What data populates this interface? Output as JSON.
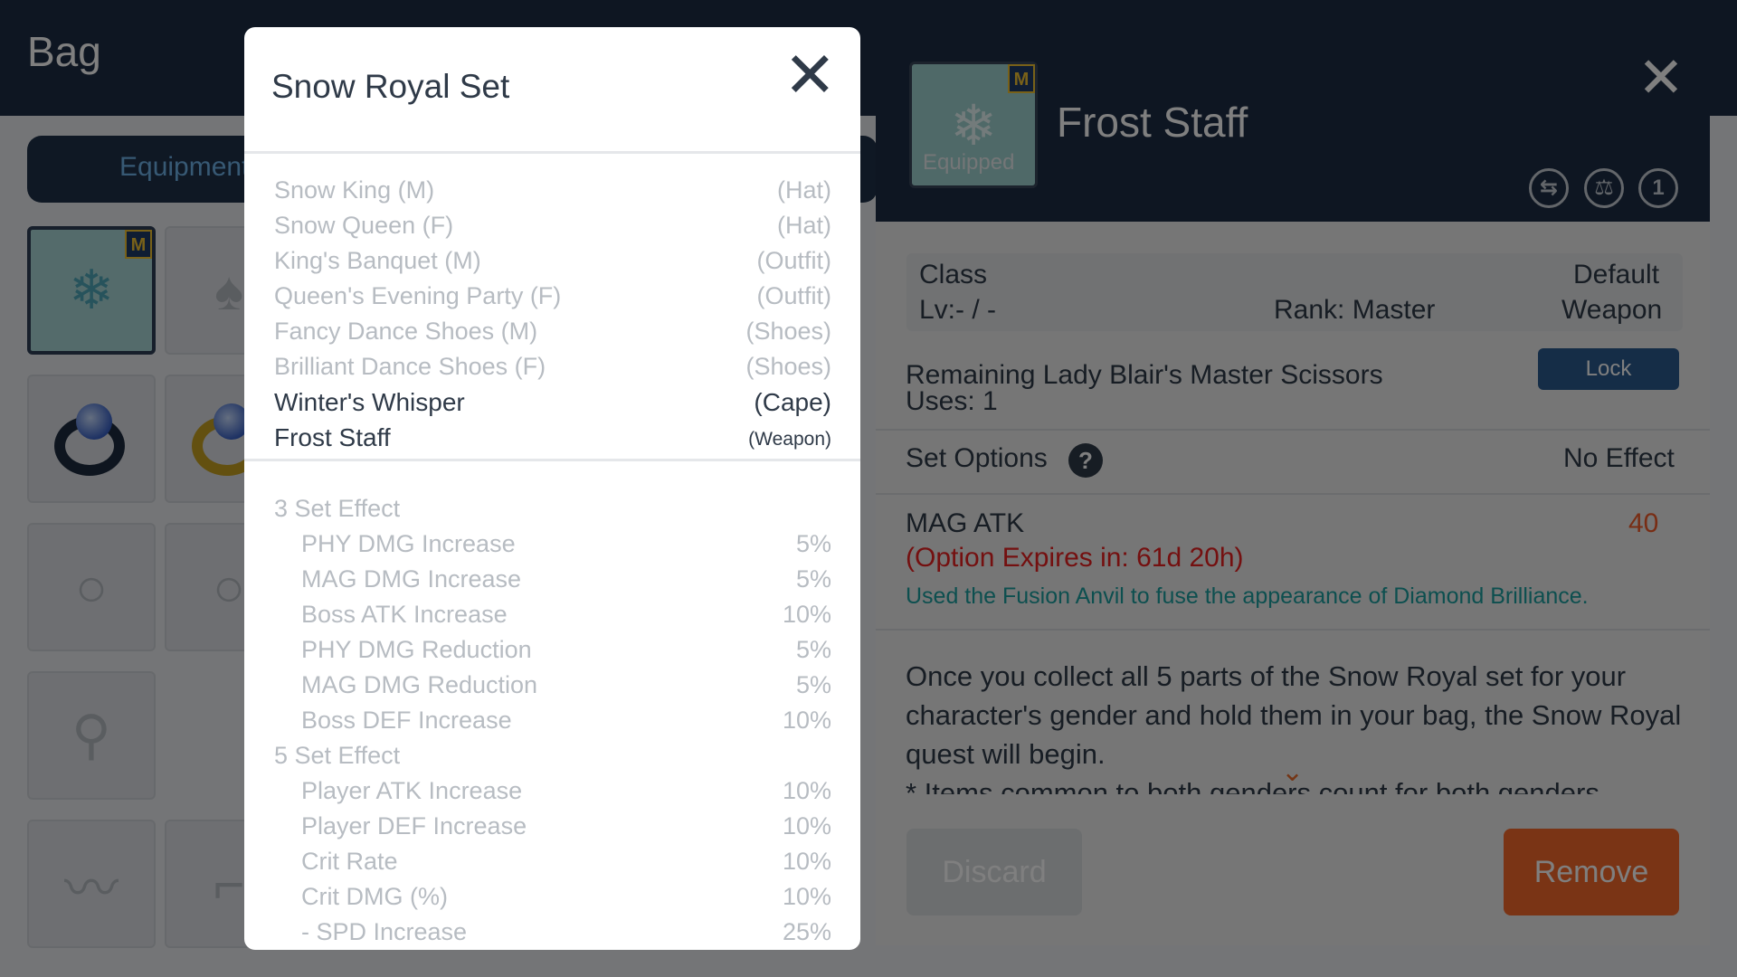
{
  "bag": {
    "title": "Bag",
    "tab_label": "Equipment"
  },
  "detail": {
    "item_name": "Frost Staff",
    "equipped_label": "Equipped",
    "badge": "M",
    "class_label": "Class",
    "class_value": "Default",
    "level": "Lv:- / -",
    "rank": "Rank: Master",
    "type": "Weapon",
    "scissors_line1": "Remaining Lady Blair's Master Scissors",
    "scissors_line2": "Uses: 1",
    "lock_label": "Lock",
    "set_options_label": "Set Options",
    "set_options_value": "No Effect",
    "stat_name": "MAG ATK",
    "stat_value": "40",
    "option_expiry": "(Option Expires in: 61d 20h)",
    "fusion_note": "Used the Fusion Anvil to fuse the appearance of Diamond Brilliance.",
    "description": "Once you collect all 5 parts of the Snow Royal set for your character's gender and hold them in your bag, the Snow Royal quest will begin.",
    "description_note": "* Items common to both genders count for both genders.",
    "discard_label": "Discard",
    "remove_label": "Remove"
  },
  "modal": {
    "title": "Snow Royal Set",
    "set_items": [
      {
        "name": "Snow King (M)",
        "slot": "(Hat)",
        "owned": false
      },
      {
        "name": "Snow Queen (F)",
        "slot": "(Hat)",
        "owned": false
      },
      {
        "name": "King's Banquet (M)",
        "slot": "(Outfit)",
        "owned": false
      },
      {
        "name": "Queen's Evening Party (F)",
        "slot": "(Outfit)",
        "owned": false
      },
      {
        "name": "Fancy Dance Shoes (M)",
        "slot": "(Shoes)",
        "owned": false
      },
      {
        "name": "Brilliant Dance Shoes (F)",
        "slot": "(Shoes)",
        "owned": false
      },
      {
        "name": "Winter's Whisper",
        "slot": "(Cape)",
        "owned": true
      },
      {
        "name": "Frost Staff",
        "slot": "(Weapon)",
        "owned": true
      }
    ],
    "effects": [
      {
        "header": "3 Set Effect"
      },
      {
        "name": "PHY DMG Increase",
        "value": "5%"
      },
      {
        "name": "MAG DMG Increase",
        "value": "5%"
      },
      {
        "name": "Boss ATK Increase",
        "value": "10%"
      },
      {
        "name": "PHY DMG Reduction",
        "value": "5%"
      },
      {
        "name": "MAG DMG Reduction",
        "value": "5%"
      },
      {
        "name": "Boss DEF Increase",
        "value": "10%"
      },
      {
        "header": "5 Set Effect"
      },
      {
        "name": "Player ATK Increase",
        "value": "10%"
      },
      {
        "name": "Player DEF Increase",
        "value": "10%"
      },
      {
        "name": "Crit Rate",
        "value": "10%"
      },
      {
        "name": "Crit DMG (%)",
        "value": "10%"
      },
      {
        "name": " - SPD Increase",
        "value": "25%"
      }
    ]
  },
  "icons": {
    "close": "close-icon",
    "help": "help-icon",
    "ring": "ring-icon",
    "earring": "earring-icon",
    "mustache": "mustache-icon",
    "glasses": "glasses-icon",
    "compare": "compare-icon",
    "upgrade": "upgrade-icon"
  },
  "colors": {
    "navy": "#1d2d44",
    "accent_orange": "#f5692b",
    "warning_red": "#e82020",
    "teal_note": "#1a9f9f"
  }
}
